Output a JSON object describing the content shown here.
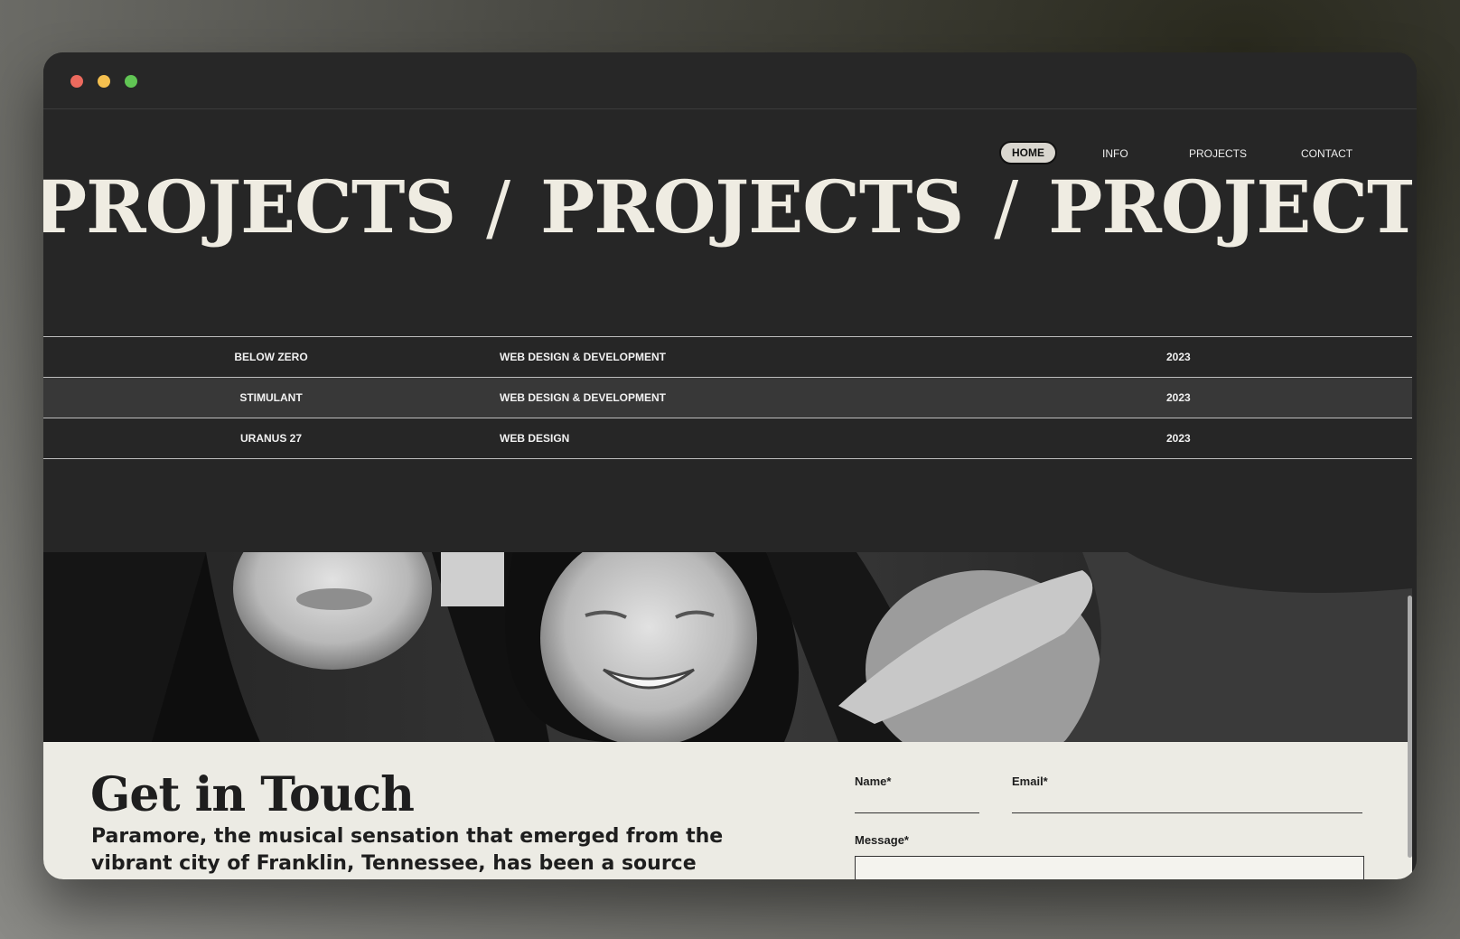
{
  "nav": {
    "items": [
      "HOME",
      "INFO",
      "PROJECTS",
      "CONTACT"
    ],
    "active": "HOME"
  },
  "marquee": {
    "word": "PROJECTS",
    "separator": "/"
  },
  "projects": [
    {
      "name": "BELOW ZERO",
      "type": "WEB DESIGN & DEVELOPMENT",
      "year": "2023"
    },
    {
      "name": "STIMULANT",
      "type": "WEB DESIGN & DEVELOPMENT",
      "year": "2023"
    },
    {
      "name": "URANUS 27",
      "type": "WEB DESIGN",
      "year": "2023"
    }
  ],
  "contact": {
    "title": "Get in Touch",
    "text": "Paramore, the musical sensation that emerged from the vibrant city of Franklin, Tennessee, has been a source of",
    "name_label": "Name*",
    "email_label": "Email*",
    "message_label": "Message*"
  },
  "colors": {
    "background": "#262626",
    "accent_light": "#efece2",
    "contact_bg": "#ecebe4"
  }
}
